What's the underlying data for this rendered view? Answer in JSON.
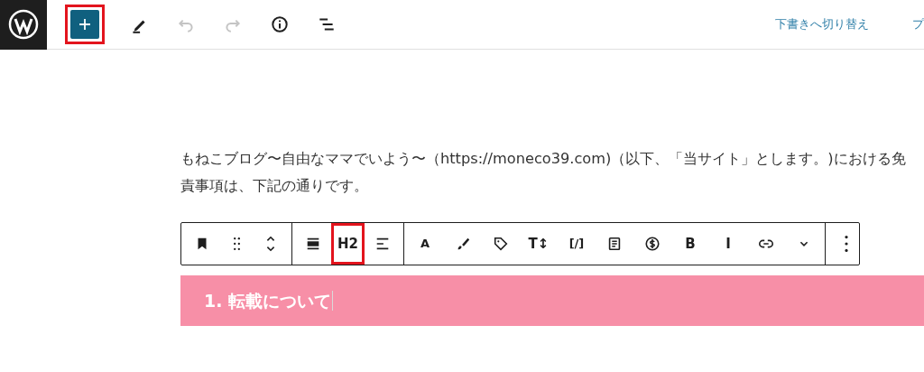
{
  "header": {
    "tools": [
      {
        "highlighted": true,
        "disabled": false
      },
      {
        "highlighted": false,
        "disabled": false
      },
      {
        "highlighted": false,
        "disabled": true
      },
      {
        "highlighted": false,
        "disabled": true
      },
      {
        "highlighted": false,
        "disabled": false
      },
      {
        "highlighted": false,
        "disabled": false
      }
    ],
    "links": [
      "下書きへ切り替え",
      "プ"
    ]
  },
  "paragraph": "もねこブログ〜自由なママでいよう〜（https://moneco39.com)（以下、「当サイト」とします。)における免責事項は、下記の通りです。",
  "block_toolbar": {
    "groups": [
      [
        {
          "kind": "icon",
          "highlighted": false
        },
        {
          "kind": "icon",
          "highlighted": false
        },
        {
          "kind": "icon",
          "highlighted": false
        }
      ],
      [
        {
          "kind": "icon",
          "highlighted": false
        },
        {
          "kind": "text",
          "label": "H2",
          "highlighted": true
        },
        {
          "kind": "icon",
          "highlighted": false
        }
      ],
      [
        {
          "kind": "text",
          "label": "A",
          "highlighted": false
        },
        {
          "kind": "icon",
          "highlighted": false
        },
        {
          "kind": "icon",
          "highlighted": false
        },
        {
          "kind": "text",
          "label": "T↕",
          "highlighted": false
        },
        {
          "kind": "text",
          "label": "[/]",
          "highlighted": false
        },
        {
          "kind": "icon",
          "highlighted": false
        },
        {
          "kind": "icon",
          "highlighted": false
        },
        {
          "kind": "text",
          "label": "B",
          "highlighted": false
        },
        {
          "kind": "text",
          "label": "I",
          "highlighted": false
        },
        {
          "kind": "icon",
          "highlighted": false
        },
        {
          "kind": "icon",
          "highlighted": false
        }
      ],
      [
        {
          "kind": "icon",
          "highlighted": false
        }
      ]
    ]
  },
  "heading": {
    "text": "1. 転載について",
    "caret": true
  }
}
